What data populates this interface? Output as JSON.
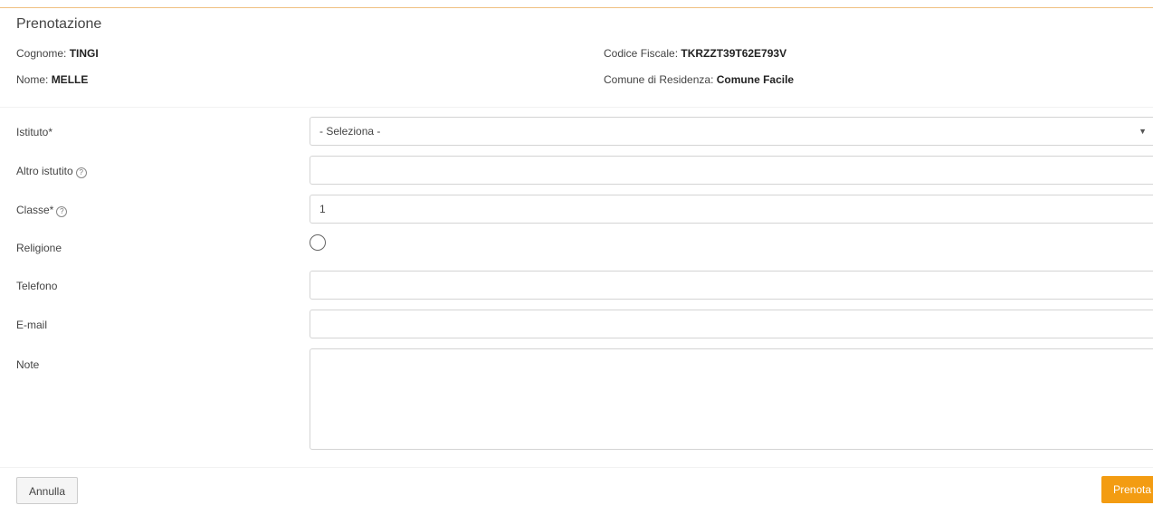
{
  "panel": {
    "title": "Prenotazione"
  },
  "person": {
    "cognome_label": "Cognome:",
    "cognome_value": "TINGI",
    "nome_label": "Nome:",
    "nome_value": "MELLE",
    "codice_fiscale_label": "Codice Fiscale:",
    "codice_fiscale_value": "TKRZZT39T62E793V",
    "comune_label": "Comune di Residenza:",
    "comune_value": "Comune Facile"
  },
  "form": {
    "istituto_label": "Istituto*",
    "istituto_value": "- Seleziona -",
    "altro_istituto_label": "Altro istutito",
    "classe_label": "Classe*",
    "classe_value": "1",
    "religione_label": "Religione",
    "telefono_label": "Telefono",
    "email_label": "E-mail",
    "note_label": "Note"
  },
  "actions": {
    "cancel_label": "Annulla",
    "submit_label": "Prenota"
  },
  "icons": {
    "help": "help-circle-icon",
    "select_arrow": "chevron-down-icon"
  },
  "colors": {
    "accent": "#f39c12",
    "top_border": "#f0c080"
  }
}
